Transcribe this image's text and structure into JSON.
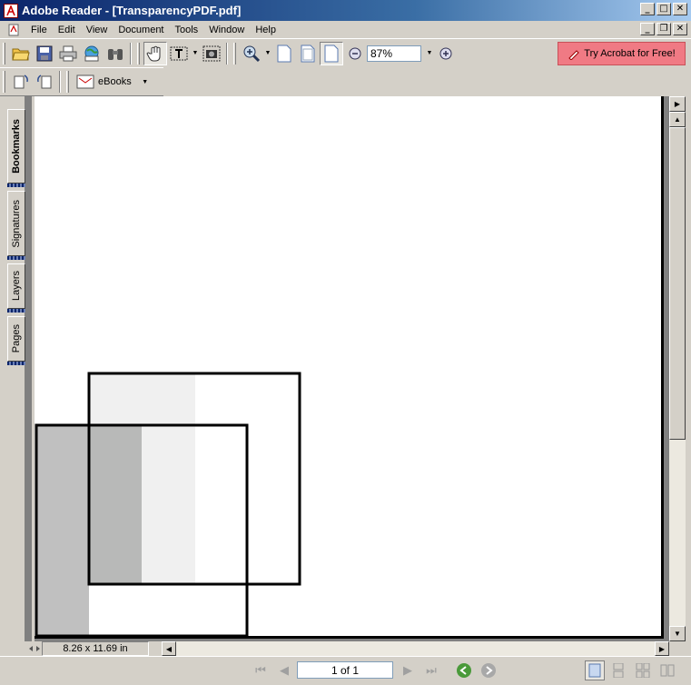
{
  "window": {
    "title": "Adobe Reader - [TransparencyPDF.pdf]"
  },
  "menu": {
    "items": [
      "File",
      "Edit",
      "View",
      "Document",
      "Tools",
      "Window",
      "Help"
    ]
  },
  "toolbar": {
    "zoom_value": "87%",
    "try_acrobat_label": "Try Acrobat for Free!"
  },
  "toolbar2": {
    "ebooks_label": "eBooks"
  },
  "side_tabs": {
    "bookmarks": "Bookmarks",
    "signatures": "Signatures",
    "layers": "Layers",
    "pages": "Pages"
  },
  "document": {
    "page_size": "8.26 x 11.69 in",
    "colors": {
      "dark_gray": "#c0c0c0",
      "mid_gray": "#b8b9b8",
      "light_gray": "#f0f0f0"
    }
  },
  "navigation": {
    "page_indicator": "1 of 1"
  },
  "colors": {
    "title_start": "#0a246a",
    "title_end": "#a6caf0",
    "chrome": "#d4d0c8",
    "try_button": "#f07a84"
  }
}
